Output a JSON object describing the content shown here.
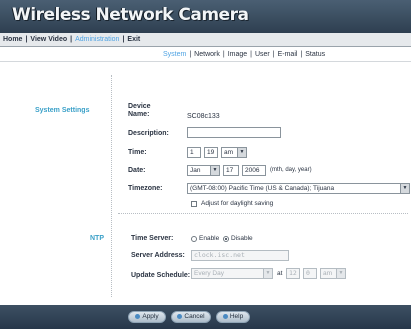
{
  "header": {
    "title": "Wireless Network Camera"
  },
  "main_nav": {
    "items": [
      {
        "label": "Home"
      },
      {
        "label": "View Video"
      },
      {
        "label": "Administration"
      },
      {
        "label": "Exit"
      }
    ],
    "active": "Administration"
  },
  "sub_nav": {
    "items": [
      {
        "label": "System"
      },
      {
        "label": "Network"
      },
      {
        "label": "Image"
      },
      {
        "label": "User"
      },
      {
        "label": "E-mail"
      },
      {
        "label": "Status"
      }
    ],
    "active": "System"
  },
  "system_settings": {
    "section_label": "System Settings",
    "device_name": {
      "label": "Device Name:",
      "value": "SC08c133"
    },
    "description": {
      "label": "Description:",
      "value": ""
    },
    "time": {
      "label": "Time:",
      "hour": "1",
      "minute": "19",
      "ampm": "am"
    },
    "date": {
      "label": "Date:",
      "month": "Jan",
      "day": "17",
      "year": "2006",
      "hint": "(mth, day, year)"
    },
    "timezone": {
      "label": "Timezone:",
      "value": "(GMT-08:00) Pacific Time (US & Canada); Tijuana"
    },
    "daylight_saving": {
      "label": "Adjust for daylight saving",
      "checked": false
    }
  },
  "ntp": {
    "section_label": "NTP",
    "time_server": {
      "label": "Time Server:",
      "options": [
        "Enable",
        "Disable"
      ],
      "selected": "Disable"
    },
    "server_address": {
      "label": "Server Address:",
      "value": "clock.isc.net"
    },
    "update_schedule": {
      "label": "Update Schedule:",
      "value": "Every Day",
      "at_label": "at",
      "hour": "12",
      "minute": "0",
      "ampm": "am"
    }
  },
  "footer": {
    "buttons": [
      {
        "label": "Apply"
      },
      {
        "label": "Cancel"
      },
      {
        "label": "Help"
      }
    ]
  },
  "colors": {
    "header_bg": "#3a4d60",
    "active_link": "#4fa3e3",
    "section_label": "#3aa0c8",
    "footer_bg": "#2f4256"
  },
  "icons": {
    "dropdown": "chevron-down-icon",
    "button_bullet": "dot-icon"
  }
}
